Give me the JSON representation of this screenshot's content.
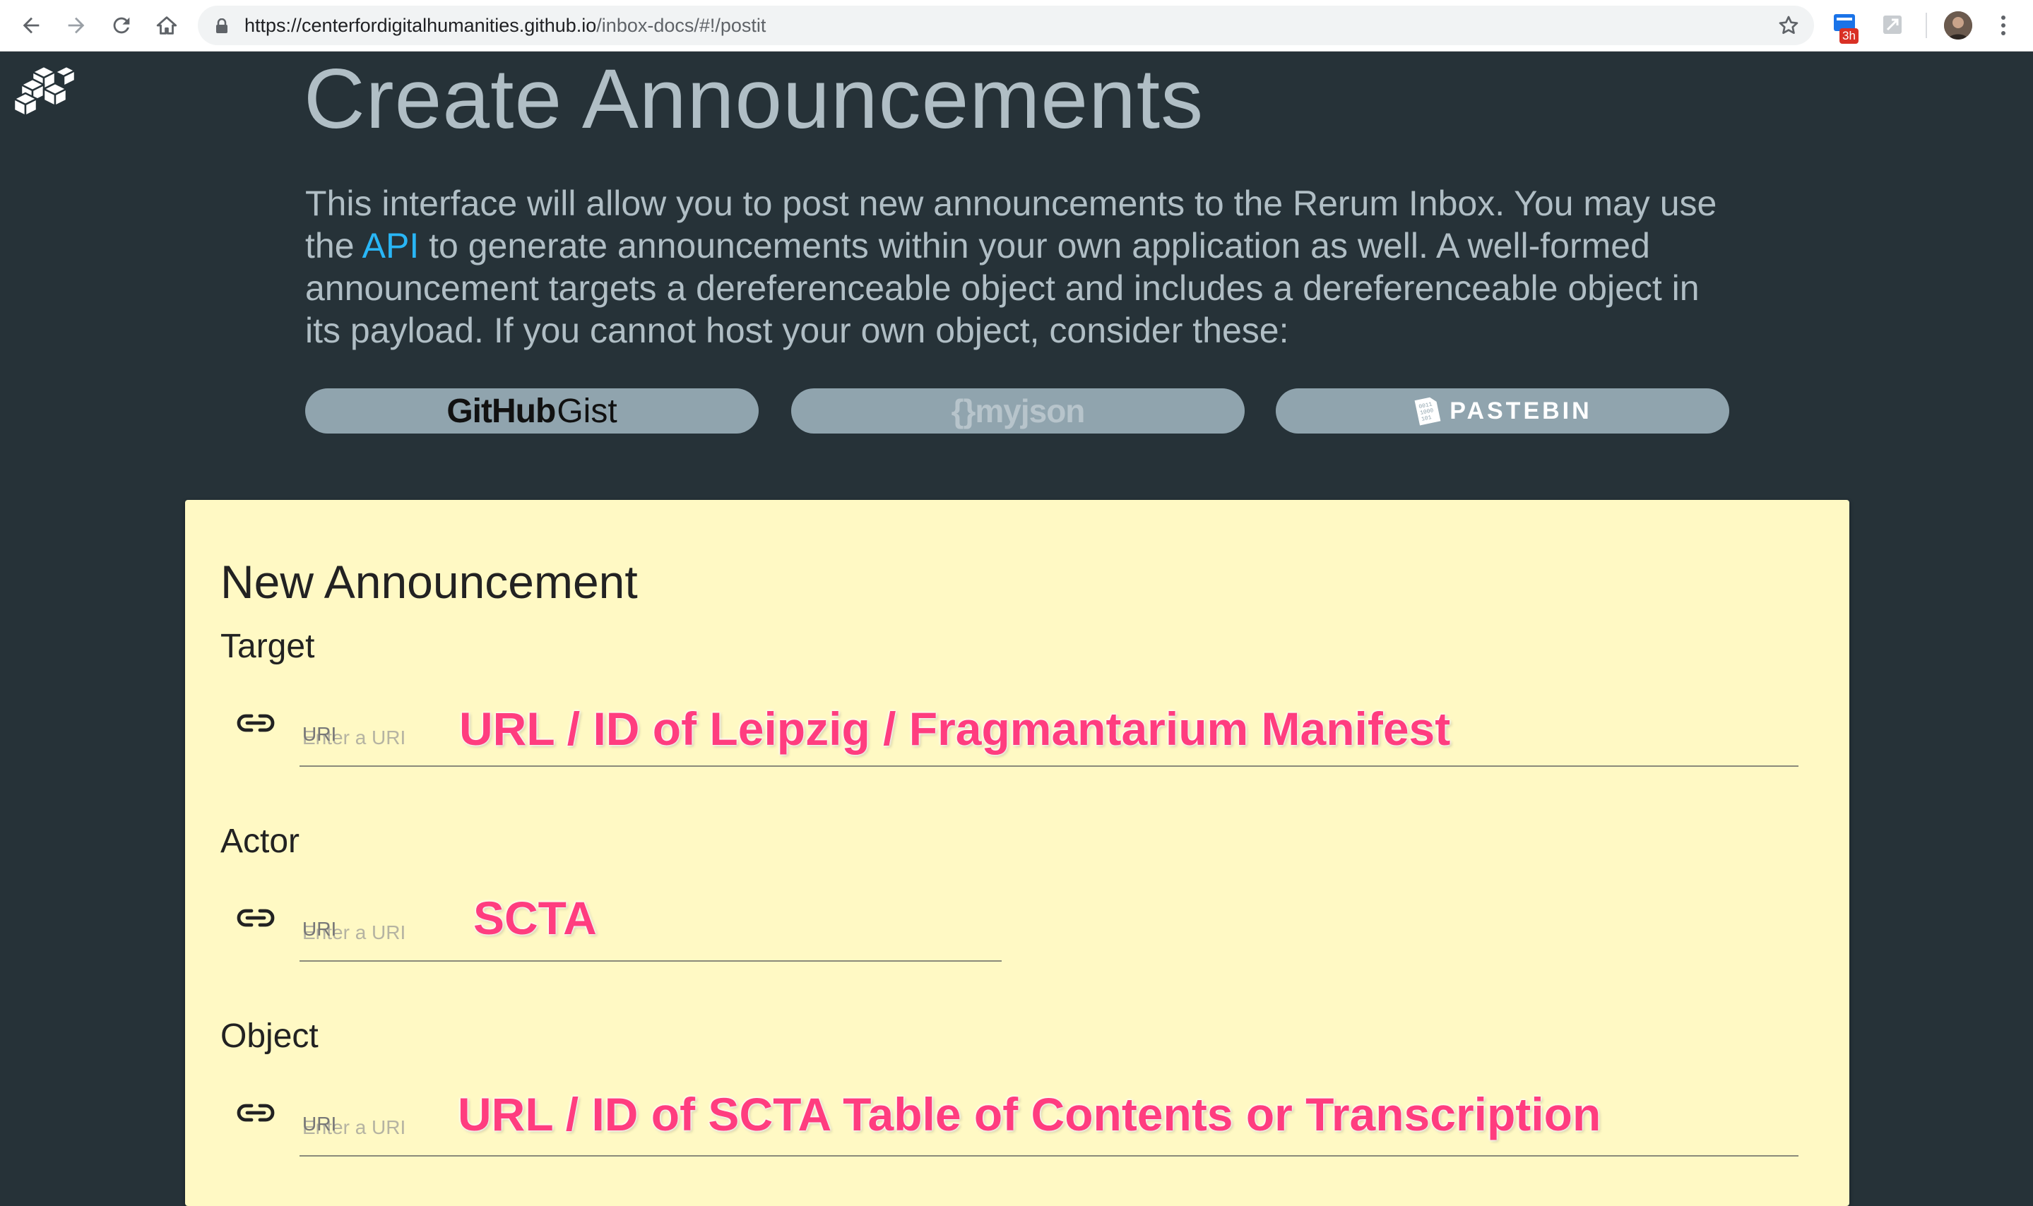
{
  "browser": {
    "url_host": "https://centerfordigitalhumanities.github.io",
    "url_path": "/inbox-docs/#!/postit",
    "extension_badge": "3h"
  },
  "header": {
    "title": "Create Announcements",
    "intro_before_link": "This interface will allow you to post new announcements to the Rerum Inbox. You may use the ",
    "intro_link": "API",
    "intro_after_link": " to generate announcements within your own application as well. A well-formed announcement targets a dereferenceable object and includes a dereferenceable object in its payload. If you cannot host your own object, consider these:"
  },
  "hosts": {
    "gist_bold": "GitHub",
    "gist_thin": "Gist",
    "myjson": "{}myjson",
    "pastebin": "PASTEBIN"
  },
  "form": {
    "title": "New Announcement",
    "fields": [
      {
        "label": "Target",
        "float_label": "URI",
        "placeholder": "Enter a URI",
        "annotation": "URL / ID of Leipzig / Fragmantarium Manifest"
      },
      {
        "label": "Actor",
        "float_label": "URI",
        "placeholder": "Enter a URI",
        "annotation": "SCTA"
      },
      {
        "label": "Object",
        "float_label": "URI",
        "placeholder": "Enter a URI",
        "annotation": "URL / ID of SCTA Table of Contents or Transcription"
      }
    ]
  },
  "colors": {
    "page_bg": "#263238",
    "heading": "#b0bec5",
    "link": "#29b6f6",
    "host_button": "#90a4ae",
    "card_bg": "#fff9c4",
    "annotation": "#ff3d7f"
  },
  "icons": [
    "back-icon",
    "forward-icon",
    "reload-icon",
    "home-icon",
    "lock-icon",
    "star-icon",
    "extension-icon",
    "menu-icon",
    "logo-cubes-icon",
    "link-icon"
  ]
}
